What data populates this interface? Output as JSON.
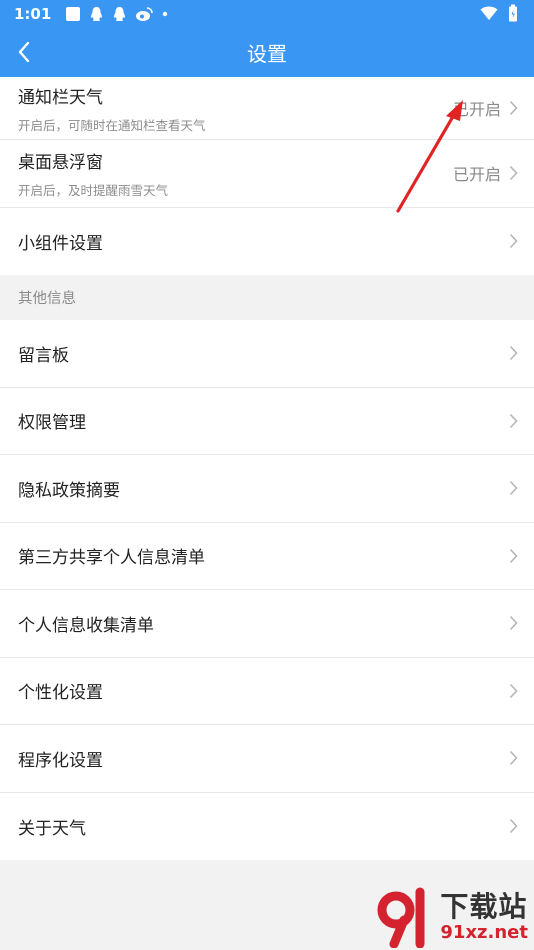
{
  "status": {
    "time": "1:01"
  },
  "toolbar": {
    "title": "设置"
  },
  "top_section": {
    "items": [
      {
        "title": "通知栏天气",
        "subtitle": "开启后，可随时在通知栏查看天气",
        "value": "已开启"
      },
      {
        "title": "桌面悬浮窗",
        "subtitle": "开启后，及时提醒雨雪天气",
        "value": "已开启"
      },
      {
        "title": "小组件设置"
      }
    ]
  },
  "other_section": {
    "heading": "其他信息",
    "items": [
      {
        "title": "留言板"
      },
      {
        "title": "权限管理"
      },
      {
        "title": "隐私政策摘要"
      },
      {
        "title": "第三方共享个人信息清单"
      },
      {
        "title": "个人信息收集清单"
      },
      {
        "title": "个性化设置"
      },
      {
        "title": "程序化设置"
      },
      {
        "title": "关于天气"
      }
    ]
  },
  "watermark": {
    "name": "下载站",
    "url": "91xz.net"
  },
  "colors": {
    "accent": "#3a96f3",
    "annotation": "#e02424",
    "watermark_red": "#d4232f"
  }
}
